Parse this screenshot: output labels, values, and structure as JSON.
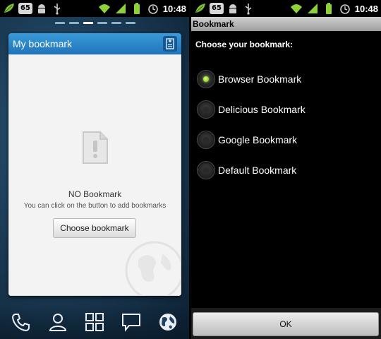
{
  "status_bar": {
    "notification_badge": "65",
    "time": "10:48"
  },
  "home_screen": {
    "widget": {
      "title": "My bookmark",
      "empty_title": "NO Bookmark",
      "empty_hint": "You can click on the button to add bookmarks",
      "choose_button": "Choose bookmark"
    },
    "dock_icons": [
      "phone-icon",
      "contacts-icon",
      "apps-grid-icon",
      "messaging-icon",
      "browser-globe-icon"
    ],
    "accent_color": "#2a86cc"
  },
  "dialog": {
    "title": "Bookmark",
    "prompt": "Choose your bookmark:",
    "options": [
      {
        "label": "Browser Bookmark",
        "selected": true
      },
      {
        "label": "Delicious Bookmark",
        "selected": false
      },
      {
        "label": "Google Bookmark",
        "selected": false
      },
      {
        "label": "Default Bookmark",
        "selected": false
      }
    ],
    "ok_label": "OK",
    "selected_color": "#9be23a"
  }
}
